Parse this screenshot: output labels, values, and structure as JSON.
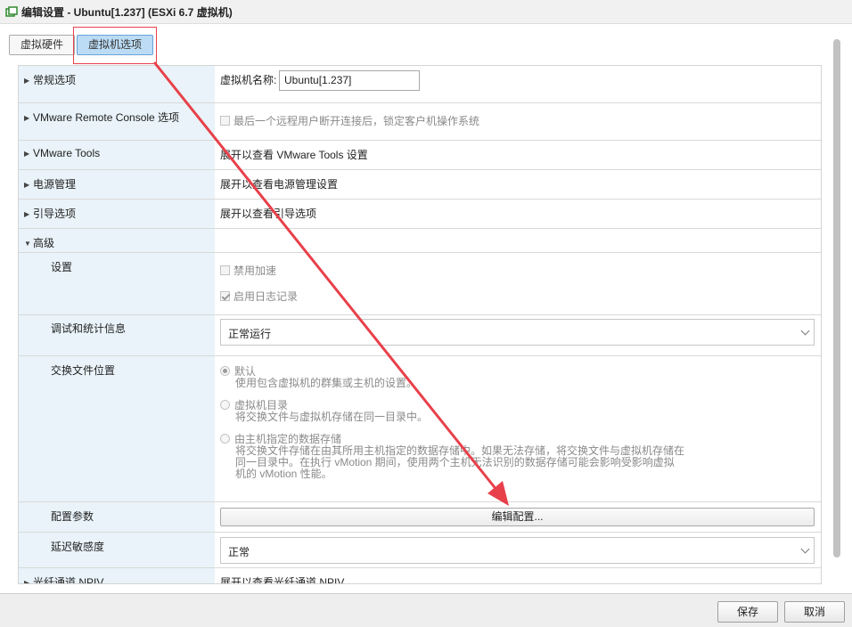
{
  "window": {
    "title": "编辑设置 - Ubuntu[1.237] (ESXi 6.7 虚拟机)"
  },
  "tabs": [
    {
      "label": "虚拟硬件",
      "active": false
    },
    {
      "label": "虚拟机选项",
      "active": true
    }
  ],
  "general": {
    "label": "常规选项",
    "vm_name_label": "虚拟机名称:",
    "vm_name_value": "Ubuntu[1.237]"
  },
  "remote_console": {
    "label": "VMware Remote Console 选项",
    "checkbox_label": "最后一个远程用户断开连接后，锁定客户机操作系统",
    "checked": false
  },
  "vmware_tools": {
    "label": "VMware Tools",
    "value": "展开以查看 VMware Tools 设置"
  },
  "power": {
    "label": "电源管理",
    "value": "展开以查看电源管理设置"
  },
  "boot": {
    "label": "引导选项",
    "value": "展开以查看引导选项"
  },
  "advanced": {
    "label": "高级",
    "settings": {
      "label": "设置",
      "disable_accel": {
        "label": "禁用加速",
        "checked": false
      },
      "enable_logging": {
        "label": "启用日志记录",
        "checked": true
      }
    },
    "debug": {
      "label": "调试和统计信息",
      "value": "正常运行"
    },
    "swap": {
      "label": "交换文件位置",
      "options": [
        {
          "title": "默认",
          "desc": "使用包含虚拟机的群集或主机的设置。",
          "selected": true
        },
        {
          "title": "虚拟机目录",
          "desc": "将交换文件与虚拟机存储在同一目录中。",
          "selected": false
        },
        {
          "title": "由主机指定的数据存储",
          "desc_lines": [
            "将交换文件存储在由其所用主机指定的数据存储中。如果无法存储，将交换文件与虚拟机存储在",
            "同一目录中。在执行 vMotion 期间，使用两个主机无法识别的数据存储可能会影响受影响虚拟",
            "机的 vMotion 性能。"
          ],
          "selected": false
        }
      ]
    },
    "config_params": {
      "label": "配置参数",
      "button": "编辑配置..."
    },
    "latency": {
      "label": "延迟敏感度",
      "value": "正常"
    }
  },
  "npiv": {
    "label": "光纤通道 NPIV",
    "value": "展开以查看光纤通道 NPIV"
  },
  "footer": {
    "save": "保存",
    "cancel": "取消"
  },
  "colors": {
    "accent_tab": "#bcdcf5",
    "label_column": "#e9f3f9",
    "annotation_red": "#e8404a"
  }
}
